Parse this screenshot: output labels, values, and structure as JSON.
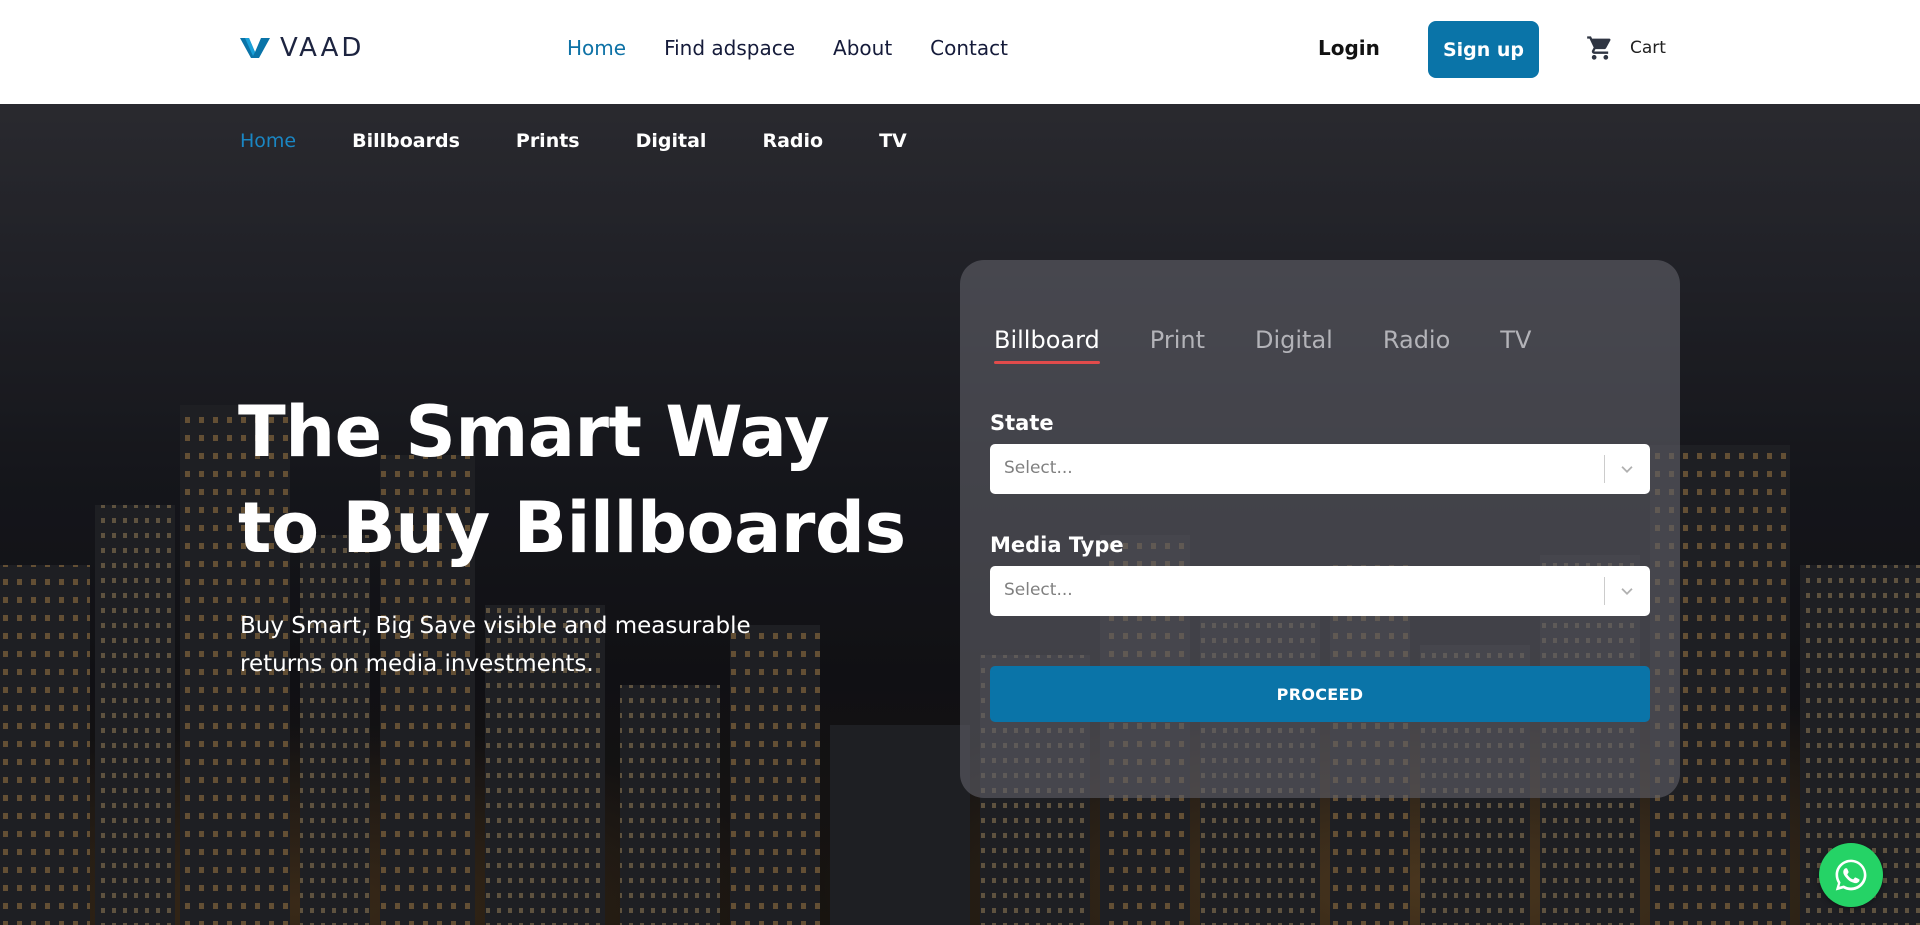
{
  "brand": {
    "name": "VAAD",
    "accent": "#0a74a8",
    "active_link": "#0e72a6"
  },
  "header": {
    "nav": [
      {
        "label": "Home",
        "active": true
      },
      {
        "label": "Find adspace",
        "active": false
      },
      {
        "label": "About",
        "active": false
      },
      {
        "label": "Contact",
        "active": false
      }
    ],
    "login_label": "Login",
    "signup_label": "Sign up",
    "cart_label": "Cart",
    "cart_icon": "cart-icon"
  },
  "subnav": [
    {
      "label": "Home",
      "active": true
    },
    {
      "label": "Billboards",
      "active": false
    },
    {
      "label": "Prints",
      "active": false
    },
    {
      "label": "Digital",
      "active": false
    },
    {
      "label": "Radio",
      "active": false
    },
    {
      "label": "TV",
      "active": false
    }
  ],
  "hero": {
    "title_line1": "The Smart Way",
    "title_line2": "to Buy Billboards",
    "subtitle": "Buy Smart, Big Save visible and measurable returns on media investments."
  },
  "search": {
    "tabs": [
      {
        "label": "Billboard",
        "active": true
      },
      {
        "label": "Print",
        "active": false
      },
      {
        "label": "Digital",
        "active": false
      },
      {
        "label": "Radio",
        "active": false
      },
      {
        "label": "TV",
        "active": false
      }
    ],
    "tab_underline_color": "#e24b4b",
    "state_label": "State",
    "state_value": "Select...",
    "media_label": "Media Type",
    "media_value": "Select...",
    "proceed_label": "PROCEED"
  },
  "whatsapp": {
    "icon": "whatsapp-icon",
    "color": "#25d366"
  }
}
